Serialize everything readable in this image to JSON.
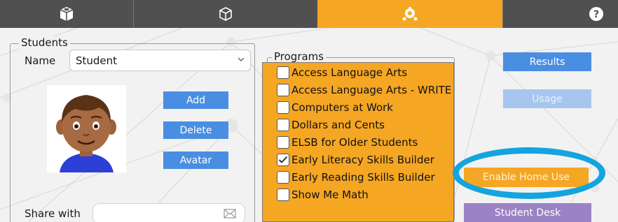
{
  "tabs": [
    {
      "icon": "box-icon",
      "active": false
    },
    {
      "icon": "cube-icon",
      "active": false
    },
    {
      "icon": "network-settings-icon",
      "active": true
    },
    {
      "icon": "help-icon",
      "active": false
    }
  ],
  "students": {
    "legend": "Students",
    "name_label": "Name",
    "name_value": "Student",
    "add_label": "Add",
    "delete_label": "Delete",
    "avatar_label": "Avatar",
    "share_label": "Share with",
    "share_value": ""
  },
  "programs": {
    "legend": "Programs",
    "items": [
      {
        "label": "Access Language Arts",
        "checked": false
      },
      {
        "label": "Access Language Arts - WRITE",
        "checked": false
      },
      {
        "label": "Computers at Work",
        "checked": false
      },
      {
        "label": "Dollars and Cents",
        "checked": false
      },
      {
        "label": "ELSB for Older Students",
        "checked": false
      },
      {
        "label": "Early Literacy Skills Builder",
        "checked": true
      },
      {
        "label": "Early Reading Skills Builder",
        "checked": false
      },
      {
        "label": "Show Me Math",
        "checked": false
      }
    ]
  },
  "actions": {
    "results_label": "Results",
    "usage_label": "Usage",
    "home_use_label": "Enable Home Use",
    "student_desk_label": "Student Desk"
  },
  "colors": {
    "accent_orange": "#f5a623",
    "button_blue": "#4a8ee2",
    "button_blue_disabled": "#a6c6ee",
    "button_purple": "#9b82c5",
    "highlight_ring": "#14a4de",
    "tab_bar": "#505050"
  }
}
